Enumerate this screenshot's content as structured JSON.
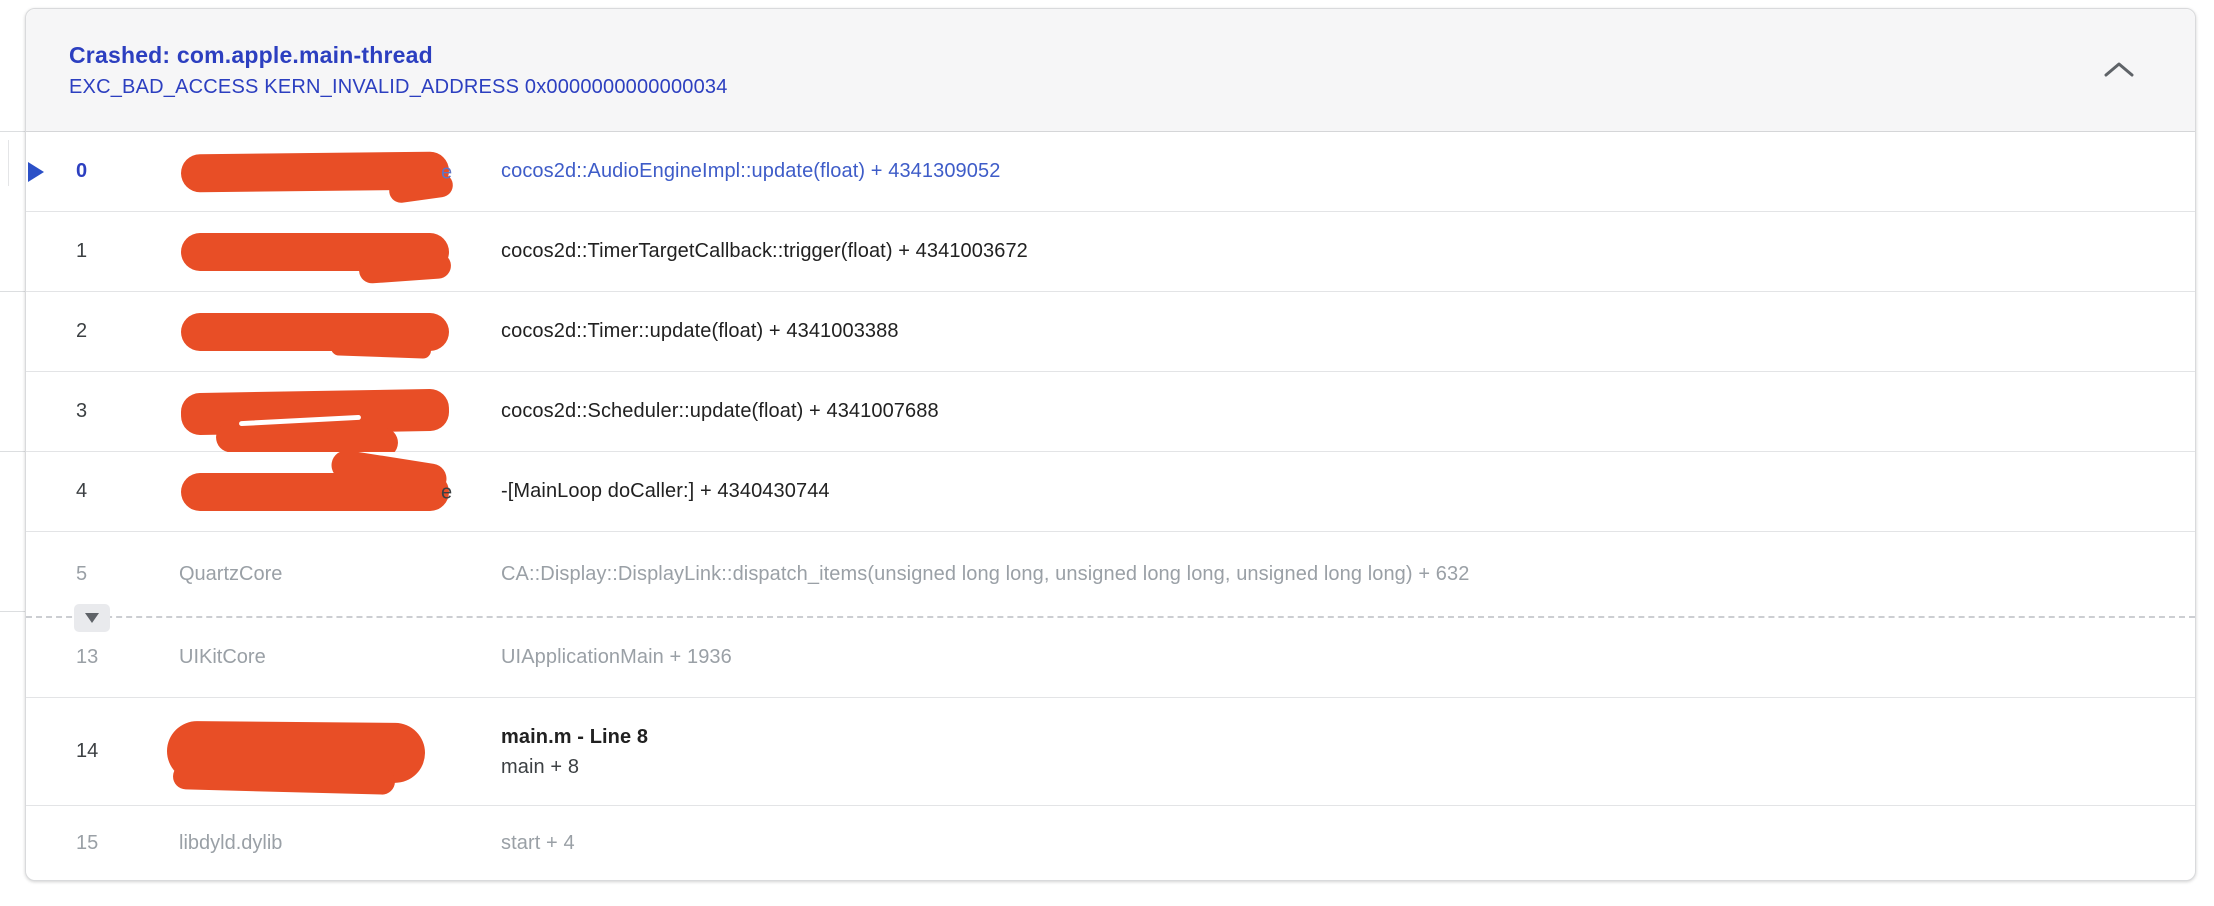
{
  "header": {
    "title": "Crashed: com.apple.main-thread",
    "subtitle": "EXC_BAD_ACCESS KERN_INVALID_ADDRESS 0x0000000000000034",
    "collapse_icon": "chevron-up-icon"
  },
  "colors": {
    "accent-blue": "#2c3fc0",
    "link-blue": "#3e5cc8",
    "redact": "#e84e26",
    "text-dark": "#3c4043",
    "text-gray": "#9aa0a6"
  },
  "expander": {
    "icon": "triangle-down-icon"
  },
  "marker": {
    "icon": "play-arrow-icon"
  },
  "frames": [
    {
      "num": "0",
      "library": "",
      "redacted": true,
      "remnant": "e",
      "symbol": "cocos2d::AudioEngineImpl::update(float) + 4341309052",
      "crashed": true
    },
    {
      "num": "1",
      "library": "",
      "redacted": true,
      "symbol": "cocos2d::TimerTargetCallback::trigger(float) + 4341003672"
    },
    {
      "num": "2",
      "library": "",
      "redacted": true,
      "symbol": "cocos2d::Timer::update(float) + 4341003388"
    },
    {
      "num": "3",
      "library": "",
      "redacted": true,
      "symbol": "cocos2d::Scheduler::update(float) + 4341007688"
    },
    {
      "num": "4",
      "library": "",
      "redacted": true,
      "remnant": "e",
      "symbol": "-[MainLoop doCaller:] + 4340430744"
    },
    {
      "num": "5",
      "library": "QuartzCore",
      "symbol": "CA::Display::DisplayLink::dispatch_items(unsigned long long, unsigned long long, unsigned long long) + 632"
    },
    {
      "num": "13",
      "library": "UIKitCore",
      "symbol": "UIApplicationMain + 1936"
    },
    {
      "num": "14",
      "library": "",
      "redacted": true,
      "symbol_title": "main.m - Line 8",
      "symbol_sub": "main + 8"
    },
    {
      "num": "15",
      "library": "libdyld.dylib",
      "symbol": "start + 4"
    }
  ]
}
